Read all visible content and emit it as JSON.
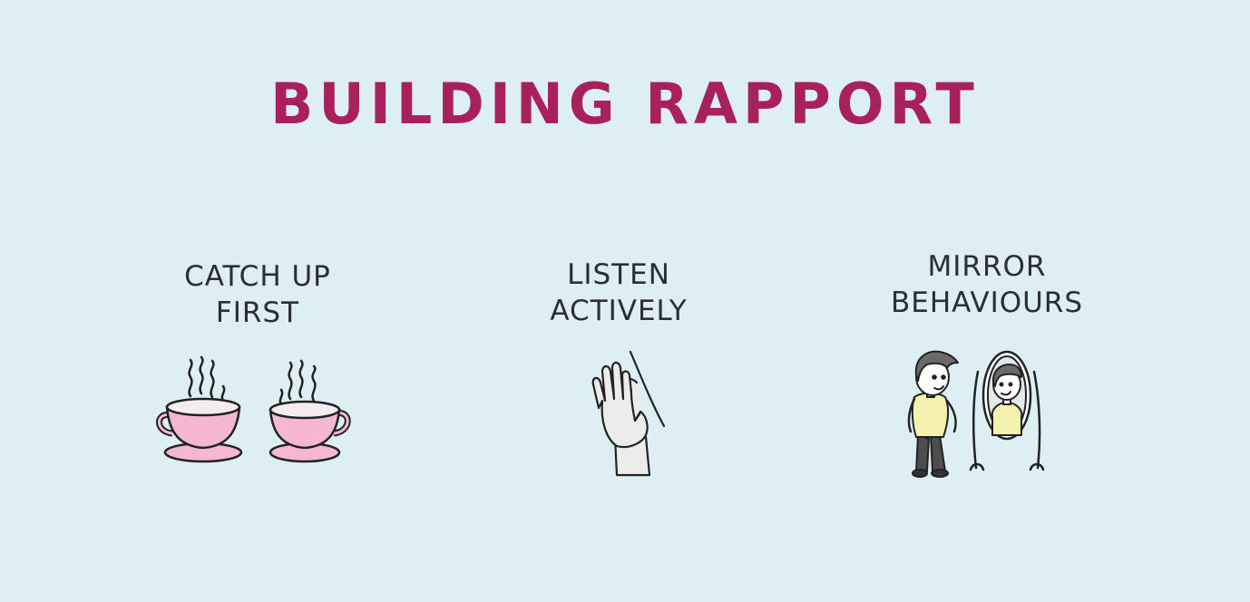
{
  "title": "BUILDING RAPPORT",
  "colors": {
    "background": "#ddeff2",
    "title": "#a8205e",
    "label": "#2b2e33",
    "cup_pink": "#f6b7d2",
    "foam": "#f5ecef",
    "hand": "#ececec",
    "shirt": "#f5f2b0",
    "hair": "#6a6a6a",
    "pants": "#4d4d4d"
  },
  "items": [
    {
      "label_line1": "CATCH UP",
      "label_line2": "FIRST",
      "icon": "coffee-cups-icon"
    },
    {
      "label_line1": "LISTEN",
      "label_line2": "ACTIVELY",
      "icon": "hand-ear-icon"
    },
    {
      "label_line1": "MIRROR",
      "label_line2": "BEHAVIOURS",
      "icon": "person-mirror-icon"
    }
  ]
}
